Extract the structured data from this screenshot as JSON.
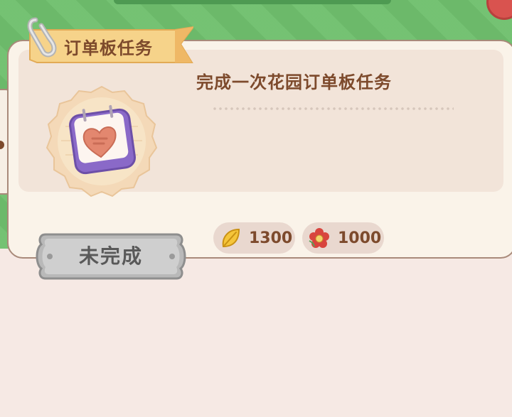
{
  "ribbon": {
    "title": "订单板任务"
  },
  "task": {
    "description": "完成一次花园订单板任务"
  },
  "rewards": [
    {
      "icon": "leaf-coin-icon",
      "value": "1300"
    },
    {
      "icon": "red-flower-icon",
      "value": "1000"
    }
  ],
  "status": {
    "label": "未完成"
  },
  "colors": {
    "background_green": "#6fbf6d",
    "card": "#faf3e9",
    "text_brown": "#7d4a2c",
    "ribbon": "#f6d38a",
    "status_button": "#b9b9b9"
  }
}
